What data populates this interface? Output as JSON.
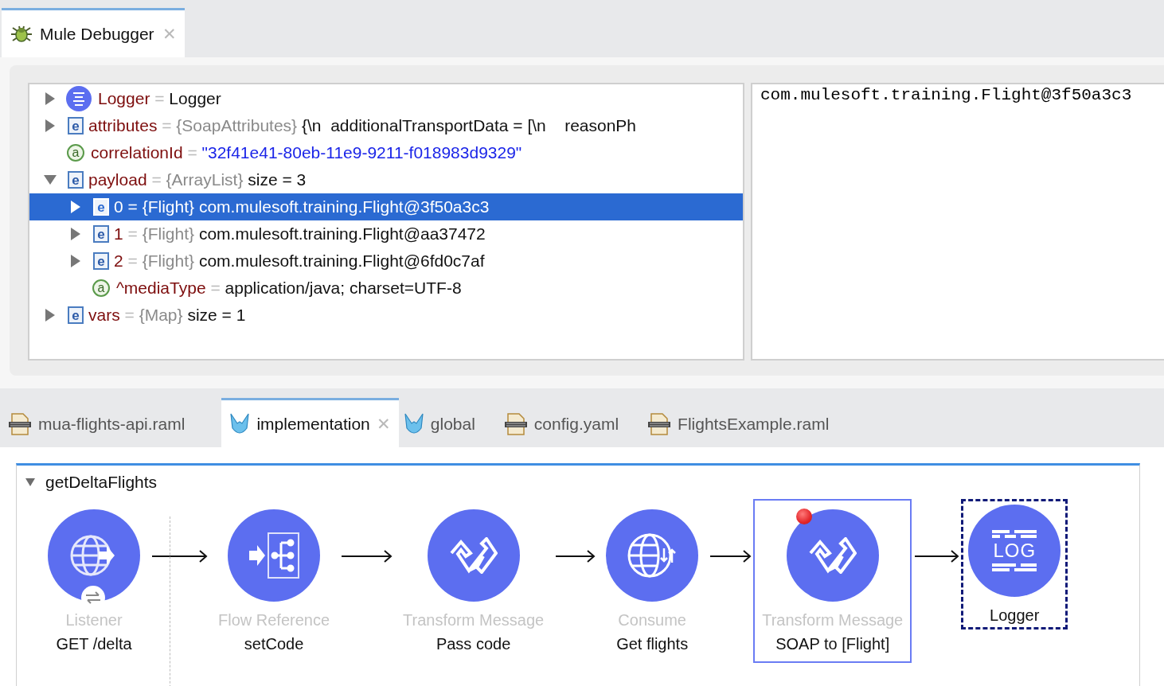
{
  "debugger_tab": {
    "label": "Mule Debugger",
    "selected": true,
    "close": "✕"
  },
  "variables": [
    {
      "kind": "processor",
      "name": "Logger",
      "separator": "=",
      "value": "Logger",
      "expanded": false,
      "selected": false
    },
    {
      "kind": "element",
      "badge": "e",
      "name": "attributes",
      "separator": "=",
      "type": "{SoapAttributes}",
      "value": "{\\n  additionalTransportData = [\\n    reasonPh",
      "expanded": false,
      "selected": false
    },
    {
      "kind": "string-attribute",
      "badge": "a",
      "name": "correlationId",
      "separator": "=",
      "value": "\"32f41e41-80eb-11e9-9211-f018983d9329\"",
      "selected": false
    },
    {
      "kind": "element",
      "badge": "e",
      "name": "payload",
      "separator": "=",
      "type": "{ArrayList}",
      "value": "size = 3",
      "expanded": true,
      "selected": false,
      "children": [
        {
          "kind": "element",
          "badge": "e",
          "name": "0",
          "separator": "=",
          "type": "{Flight}",
          "value": "com.mulesoft.training.Flight@3f50a3c3",
          "expanded": false,
          "selected": true
        },
        {
          "kind": "element",
          "badge": "e",
          "name": "1",
          "separator": "=",
          "type": "{Flight}",
          "value": "com.mulesoft.training.Flight@aa37472",
          "expanded": false,
          "selected": false
        },
        {
          "kind": "element",
          "badge": "e",
          "name": "2",
          "separator": "=",
          "type": "{Flight}",
          "value": "com.mulesoft.training.Flight@6fd0c7af",
          "expanded": false,
          "selected": false
        },
        {
          "kind": "attribute",
          "badge": "a",
          "name": "^mediaType",
          "separator": "=",
          "value": "application/java; charset=UTF-8",
          "selected": false
        }
      ]
    },
    {
      "kind": "element",
      "badge": "e",
      "name": "vars",
      "separator": "=",
      "type": "{Map}",
      "value": "size = 1",
      "expanded": false,
      "selected": false
    }
  ],
  "detail": "com.mulesoft.training.Flight@3f50a3c3",
  "editor_tabs": [
    {
      "kind": "raml",
      "label": "mua-flights-api.raml",
      "selected": false
    },
    {
      "kind": "mule",
      "label": "implementation",
      "selected": true,
      "close": "✕"
    },
    {
      "kind": "mule",
      "label": "global",
      "selected": false
    },
    {
      "kind": "raml",
      "label": "config.yaml",
      "selected": false
    },
    {
      "kind": "raml",
      "label": "FlightsExample.raml",
      "selected": false
    }
  ],
  "flow": {
    "name": "getDeltaFlights",
    "expanded": true,
    "components": [
      {
        "kind": "listener",
        "type": "Listener",
        "label": "GET /delta",
        "selected": false,
        "current": false,
        "breakpoint": false
      },
      {
        "kind": "flow-reference",
        "type": "Flow Reference",
        "label": "setCode",
        "selected": false,
        "current": false,
        "breakpoint": false
      },
      {
        "kind": "transform",
        "type": "Transform Message",
        "label": "Pass code",
        "selected": false,
        "current": false,
        "breakpoint": false
      },
      {
        "kind": "consume",
        "type": "Consume",
        "label": "Get flights",
        "selected": false,
        "current": false,
        "breakpoint": false
      },
      {
        "kind": "transform",
        "type": "Transform Message",
        "label": "SOAP to [Flight]",
        "selected": true,
        "current": false,
        "breakpoint": true
      },
      {
        "kind": "logger",
        "icon_text": "LOG",
        "label": "Logger",
        "selected": false,
        "current": true,
        "breakpoint": false
      }
    ]
  }
}
